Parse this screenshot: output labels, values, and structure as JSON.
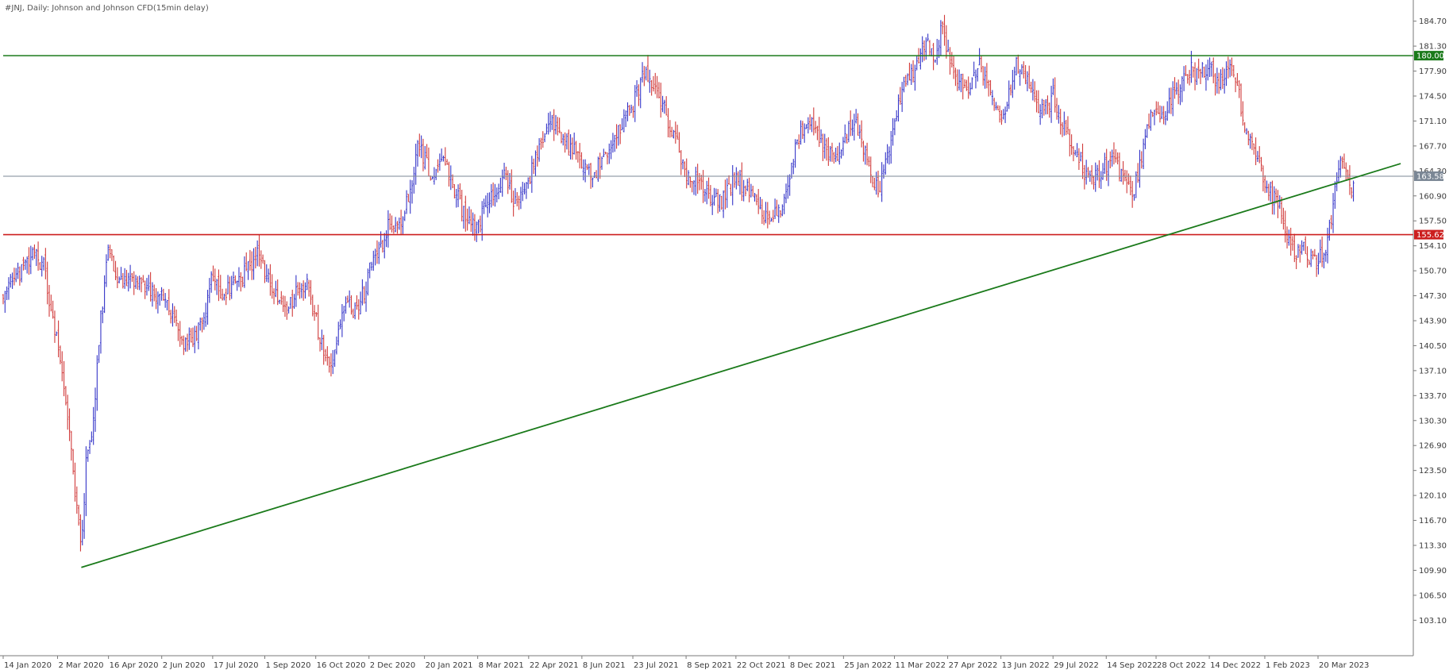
{
  "header": {
    "title": "#JNJ, Daily:  Johnson and Johnson CFD(15min delay)"
  },
  "chart_data": {
    "type": "bar",
    "style": "OHLC bars",
    "symbol": "#JNJ",
    "timeframe": "Daily",
    "ylim": [
      100.0,
      186.5
    ],
    "y_ticks": [
      184.7,
      181.3,
      177.9,
      174.5,
      171.1,
      167.7,
      164.3,
      160.9,
      157.5,
      154.1,
      150.7,
      147.3,
      143.9,
      140.5,
      137.1,
      133.7,
      130.3,
      126.9,
      123.5,
      120.1,
      116.7,
      113.3,
      109.9,
      106.5,
      103.1
    ],
    "x_tick_labels": [
      "14 Jan 2020",
      "2 Mar 2020",
      "16 Apr 2020",
      "2 Jun 2020",
      "17 Jul 2020",
      "1 Sep 2020",
      "16 Oct 2020",
      "2 Dec 2020",
      "20 Jan 2021",
      "8 Mar 2021",
      "22 Apr 2021",
      "8 Jun 2021",
      "23 Jul 2021",
      "8 Sep 2021",
      "22 Oct 2021",
      "8 Dec 2021",
      "25 Jan 2022",
      "11 Mar 2022",
      "27 Apr 2022",
      "13 Jun 2022",
      "29 Jul 2022",
      "14 Sep 2022",
      "28 Oct 2022",
      "14 Dec 2022",
      "1 Feb 2023",
      "20 Mar 2023"
    ],
    "price_path": [
      [
        "14 Jan 2020",
        148.0
      ],
      [
        "1 Feb 2020",
        151.0
      ],
      [
        "10 Feb 2020",
        153.2
      ],
      [
        "20 Feb 2020",
        151.0
      ],
      [
        "25 Feb 2020",
        145.0
      ],
      [
        "2 Mar 2020",
        141.5
      ],
      [
        "9 Mar 2020",
        134.0
      ],
      [
        "16 Mar 2020",
        123.0
      ],
      [
        "23 Mar 2020",
        113.5
      ],
      [
        "27 Mar 2020",
        124.0
      ],
      [
        "2 Apr 2020",
        129.5
      ],
      [
        "9 Apr 2020",
        144.0
      ],
      [
        "16 Apr 2020",
        154.0
      ],
      [
        "24 Apr 2020",
        150.0
      ],
      [
        "5 May 2020",
        149.0
      ],
      [
        "15 May 2020",
        148.5
      ],
      [
        "26 May 2020",
        148.0
      ],
      [
        "2 Jun 2020",
        147.0
      ],
      [
        "10 Jun 2020",
        145.0
      ],
      [
        "20 Jun 2020",
        141.0
      ],
      [
        "30 Jun 2020",
        141.5
      ],
      [
        "8 Jul 2020",
        144.0
      ],
      [
        "17 Jul 2020",
        150.0
      ],
      [
        "25 Jul 2020",
        147.5
      ],
      [
        "5 Aug 2020",
        149.0
      ],
      [
        "15 Aug 2020",
        150.5
      ],
      [
        "25 Aug 2020",
        153.0
      ],
      [
        "1 Sep 2020",
        151.0
      ],
      [
        "10 Sep 2020",
        147.5
      ],
      [
        "20 Sep 2020",
        145.0
      ],
      [
        "30 Sep 2020",
        148.0
      ],
      [
        "8 Oct 2020",
        149.0
      ],
      [
        "16 Oct 2020",
        144.0
      ],
      [
        "22 Oct 2020",
        140.0
      ],
      [
        "30 Oct 2020",
        137.5
      ],
      [
        "5 Nov 2020",
        142.5
      ],
      [
        "12 Nov 2020",
        147.0
      ],
      [
        "20 Nov 2020",
        145.0
      ],
      [
        "28 Nov 2020",
        148.0
      ],
      [
        "2 Dec 2020",
        150.5
      ],
      [
        "10 Dec 2020",
        153.0
      ],
      [
        "20 Dec 2020",
        157.0
      ],
      [
        "31 Dec 2020",
        157.5
      ],
      [
        "8 Jan 2021",
        162.0
      ],
      [
        "15 Jan 2021",
        168.0
      ],
      [
        "20 Jan 2021",
        166.0
      ],
      [
        "28 Jan 2021",
        163.0
      ],
      [
        "5 Feb 2021",
        165.5
      ],
      [
        "15 Feb 2021",
        162.0
      ],
      [
        "25 Feb 2021",
        158.0
      ],
      [
        "8 Mar 2021",
        156.5
      ],
      [
        "15 Mar 2021",
        160.0
      ],
      [
        "25 Mar 2021",
        161.5
      ],
      [
        "1 Apr 2021",
        163.5
      ],
      [
        "10 Apr 2021",
        160.0
      ],
      [
        "22 Apr 2021",
        163.0
      ],
      [
        "1 May 2021",
        168.0
      ],
      [
        "10 May 2021",
        171.0
      ],
      [
        "20 May 2021",
        169.0
      ],
      [
        "1 Jun 2021",
        167.0
      ],
      [
        "8 Jun 2021",
        165.5
      ],
      [
        "18 Jun 2021",
        164.0
      ],
      [
        "28 Jun 2021",
        166.0
      ],
      [
        "8 Jul 2021",
        168.5
      ],
      [
        "15 Jul 2021",
        172.0
      ],
      [
        "23 Jul 2021",
        173.0
      ],
      [
        "3 Aug 2021",
        178.5
      ],
      [
        "10 Aug 2021",
        176.0
      ],
      [
        "20 Aug 2021",
        172.5
      ],
      [
        "30 Aug 2021",
        168.5
      ],
      [
        "8 Sep 2021",
        164.0
      ],
      [
        "18 Sep 2021",
        163.5
      ],
      [
        "28 Sep 2021",
        161.0
      ],
      [
        "8 Oct 2021",
        160.0
      ],
      [
        "15 Oct 2021",
        162.0
      ],
      [
        "22 Oct 2021",
        163.0
      ],
      [
        "1 Nov 2021",
        162.0
      ],
      [
        "10 Nov 2021",
        160.0
      ],
      [
        "20 Nov 2021",
        157.5
      ],
      [
        "1 Dec 2021",
        159.0
      ],
      [
        "8 Dec 2021",
        163.5
      ],
      [
        "15 Dec 2021",
        168.5
      ],
      [
        "22 Dec 2021",
        171.0
      ],
      [
        "31 Dec 2021",
        170.5
      ],
      [
        "10 Jan 2022",
        167.0
      ],
      [
        "17 Jan 2022",
        166.0
      ],
      [
        "25 Jan 2022",
        168.0
      ],
      [
        "3 Feb 2022",
        171.5
      ],
      [
        "10 Feb 2022",
        168.0
      ],
      [
        "18 Feb 2022",
        164.5
      ],
      [
        "25 Feb 2022",
        161.0
      ],
      [
        "3 Mar 2022",
        165.0
      ],
      [
        "11 Mar 2022",
        171.0
      ],
      [
        "20 Mar 2022",
        176.0
      ],
      [
        "30 Mar 2022",
        178.0
      ],
      [
        "8 Apr 2022",
        182.5
      ],
      [
        "15 Apr 2022",
        180.0
      ],
      [
        "22 Apr 2022",
        183.5
      ],
      [
        "27 Apr 2022",
        180.0
      ],
      [
        "5 May 2022",
        176.5
      ],
      [
        "15 May 2022",
        176.0
      ],
      [
        "25 May 2022",
        178.5
      ],
      [
        "3 Jun 2022",
        176.0
      ],
      [
        "10 Jun 2022",
        172.0
      ],
      [
        "13 Jun 2022",
        170.0
      ],
      [
        "20 Jun 2022",
        175.0
      ],
      [
        "27 Jun 2022",
        179.0
      ],
      [
        "5 Jul 2022",
        177.0
      ],
      [
        "12 Jul 2022",
        174.0
      ],
      [
        "20 Jul 2022",
        172.5
      ],
      [
        "29 Jul 2022",
        174.5
      ],
      [
        "5 Aug 2022",
        171.0
      ],
      [
        "12 Aug 2022",
        168.5
      ],
      [
        "20 Aug 2022",
        166.0
      ],
      [
        "30 Aug 2022",
        163.0
      ],
      [
        "5 Sep 2022",
        164.0
      ],
      [
        "14 Sep 2022",
        165.0
      ],
      [
        "22 Sep 2022",
        165.5
      ],
      [
        "30 Sep 2022",
        163.0
      ],
      [
        "7 Oct 2022",
        161.0
      ],
      [
        "14 Oct 2022",
        165.0
      ],
      [
        "20 Oct 2022",
        170.0
      ],
      [
        "28 Oct 2022",
        173.0
      ],
      [
        "5 Nov 2022",
        171.5
      ],
      [
        "12 Nov 2022",
        174.5
      ],
      [
        "20 Nov 2022",
        176.5
      ],
      [
        "28 Nov 2022",
        178.0
      ],
      [
        "5 Dec 2022",
        177.5
      ],
      [
        "14 Dec 2022",
        178.5
      ],
      [
        "20 Dec 2022",
        176.0
      ],
      [
        "28 Dec 2022",
        178.0
      ],
      [
        "3 Jan 2023",
        179.0
      ],
      [
        "10 Jan 2023",
        174.0
      ],
      [
        "17 Jan 2023",
        169.0
      ],
      [
        "24 Jan 2023",
        167.0
      ],
      [
        "1 Feb 2023",
        162.5
      ],
      [
        "8 Feb 2023",
        161.0
      ],
      [
        "15 Feb 2023",
        159.0
      ],
      [
        "22 Feb 2023",
        155.0
      ],
      [
        "1 Mar 2023",
        153.0
      ],
      [
        "8 Mar 2023",
        153.5
      ],
      [
        "15 Mar 2023",
        152.5
      ],
      [
        "20 Mar 2023",
        152.0
      ],
      [
        "27 Mar 2023",
        154.0
      ],
      [
        "3 Apr 2023",
        160.0
      ],
      [
        "8 Apr 2023",
        165.5
      ],
      [
        "13 Apr 2023",
        164.5
      ],
      [
        "18 Apr 2023",
        162.0
      ],
      [
        "21 Apr 2023",
        163.58
      ]
    ],
    "horizontal_lines": [
      {
        "value": 180.0,
        "label": "180.00",
        "color": "#1a7a1a"
      },
      {
        "value": 163.58,
        "label": "163.58",
        "color": "#7b8795"
      },
      {
        "value": 155.62,
        "label": "155.62",
        "color": "#cc1f1f"
      }
    ],
    "trendline": {
      "color": "#1a7a1a",
      "start": {
        "date": "23 Mar 2020",
        "price": 110.3
      },
      "end": {
        "date": "1 Jun 2023",
        "price": 165.3
      }
    },
    "series_colors": {
      "up": "#3535c8",
      "down": "#d13b3b"
    },
    "grid": false,
    "legend": "none"
  }
}
